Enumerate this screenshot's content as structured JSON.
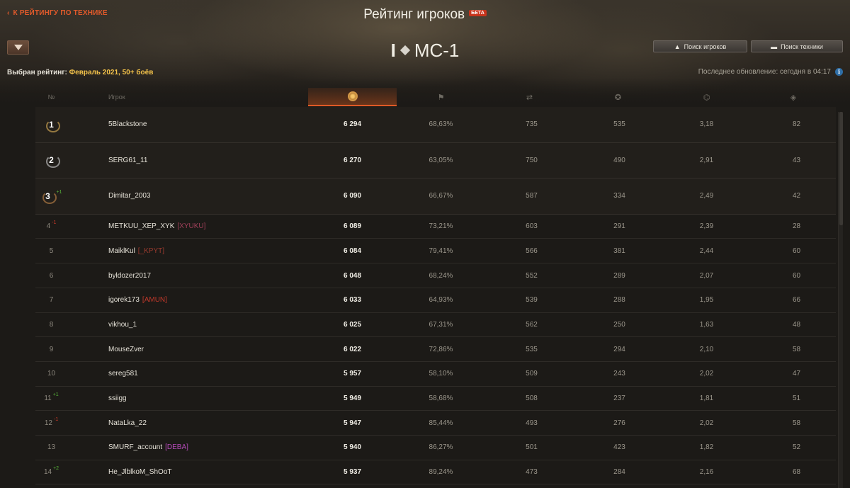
{
  "header": {
    "back_label": "К РЕЙТИНГУ ПО ТЕХНИКЕ",
    "title": "Рейтинг игроков",
    "beta_badge": "БЕТА",
    "vehicle_tier": "I",
    "vehicle_name": "МС-1",
    "search_players_label": "Поиск игроков",
    "search_vehicles_label": "Поиск техники"
  },
  "status": {
    "selected_prefix": "Выбран рейтинг:",
    "selected_value": "Февраль 2021, 50+ боёв",
    "last_update": "Последнее обновление: сегодня в 04:17"
  },
  "columns": {
    "rank": "№",
    "player": "Игрок",
    "icons": [
      "rating-medal-icon",
      "flag-icon",
      "damage-icon",
      "star-icon",
      "tank-kills-icon",
      "spotted-icon"
    ]
  },
  "colors": {
    "accent": "#e05a26",
    "gold": "#f3c24a",
    "delta_up": "#58b63a",
    "delta_down": "#d23a2a"
  },
  "rows": [
    {
      "rank": "1",
      "medal": "1",
      "delta": "",
      "delta_dir": "",
      "player": "5Blackstone",
      "clan": "",
      "clan_color": "",
      "rating": "6 294",
      "wins": "68,63%",
      "damage": "735",
      "exp": "535",
      "kills": "3,18",
      "spotted": "82"
    },
    {
      "rank": "2",
      "medal": "2",
      "delta": "",
      "delta_dir": "",
      "player": "SERG61_11",
      "clan": "",
      "clan_color": "",
      "rating": "6 270",
      "wins": "63,05%",
      "damage": "750",
      "exp": "490",
      "kills": "2,91",
      "spotted": "43"
    },
    {
      "rank": "3",
      "medal": "3",
      "delta": "+1",
      "delta_dir": "up",
      "player": "Dimitar_2003",
      "clan": "",
      "clan_color": "",
      "rating": "6 090",
      "wins": "66,67%",
      "damage": "587",
      "exp": "334",
      "kills": "2,49",
      "spotted": "42"
    },
    {
      "rank": "4",
      "medal": "",
      "delta": "-1",
      "delta_dir": "down",
      "player": "METKUU_XEP_XYK",
      "clan": "[XYUKU]",
      "clan_color": "#a0405a",
      "rating": "6 089",
      "wins": "73,21%",
      "damage": "603",
      "exp": "291",
      "kills": "2,39",
      "spotted": "28"
    },
    {
      "rank": "5",
      "medal": "",
      "delta": "",
      "delta_dir": "",
      "player": "MaiklKul",
      "clan": "[_KPYT]",
      "clan_color": "#9a3a2e",
      "rating": "6 084",
      "wins": "79,41%",
      "damage": "566",
      "exp": "381",
      "kills": "2,44",
      "spotted": "60"
    },
    {
      "rank": "6",
      "medal": "",
      "delta": "",
      "delta_dir": "",
      "player": "byldozer2017",
      "clan": "",
      "clan_color": "",
      "rating": "6 048",
      "wins": "68,24%",
      "damage": "552",
      "exp": "289",
      "kills": "2,07",
      "spotted": "60"
    },
    {
      "rank": "7",
      "medal": "",
      "delta": "",
      "delta_dir": "",
      "player": "igorek173",
      "clan": "[AMUN]",
      "clan_color": "#c0392b",
      "rating": "6 033",
      "wins": "64,93%",
      "damage": "539",
      "exp": "288",
      "kills": "1,95",
      "spotted": "66"
    },
    {
      "rank": "8",
      "medal": "",
      "delta": "",
      "delta_dir": "",
      "player": "vikhou_1",
      "clan": "",
      "clan_color": "",
      "rating": "6 025",
      "wins": "67,31%",
      "damage": "562",
      "exp": "250",
      "kills": "1,63",
      "spotted": "48"
    },
    {
      "rank": "9",
      "medal": "",
      "delta": "",
      "delta_dir": "",
      "player": "MouseZver",
      "clan": "",
      "clan_color": "",
      "rating": "6 022",
      "wins": "72,86%",
      "damage": "535",
      "exp": "294",
      "kills": "2,10",
      "spotted": "58"
    },
    {
      "rank": "10",
      "medal": "",
      "delta": "",
      "delta_dir": "",
      "player": "sereg581",
      "clan": "",
      "clan_color": "",
      "rating": "5 957",
      "wins": "58,10%",
      "damage": "509",
      "exp": "243",
      "kills": "2,02",
      "spotted": "47"
    },
    {
      "rank": "11",
      "medal": "",
      "delta": "+1",
      "delta_dir": "up",
      "player": "ssiigg",
      "clan": "",
      "clan_color": "",
      "rating": "5 949",
      "wins": "58,68%",
      "damage": "508",
      "exp": "237",
      "kills": "1,81",
      "spotted": "51"
    },
    {
      "rank": "12",
      "medal": "",
      "delta": "-1",
      "delta_dir": "down",
      "player": "NataLka_22",
      "clan": "",
      "clan_color": "",
      "rating": "5 947",
      "wins": "85,44%",
      "damage": "493",
      "exp": "276",
      "kills": "2,02",
      "spotted": "58"
    },
    {
      "rank": "13",
      "medal": "",
      "delta": "",
      "delta_dir": "",
      "player": "SMURF_account",
      "clan": "[DEBA]",
      "clan_color": "#b44ab8",
      "rating": "5 940",
      "wins": "86,27%",
      "damage": "501",
      "exp": "423",
      "kills": "1,82",
      "spotted": "52"
    },
    {
      "rank": "14",
      "medal": "",
      "delta": "+2",
      "delta_dir": "up",
      "player": "He_JlblkoM_ShOoT",
      "clan": "",
      "clan_color": "",
      "rating": "5 937",
      "wins": "89,24%",
      "damage": "473",
      "exp": "284",
      "kills": "2,16",
      "spotted": "68"
    }
  ]
}
